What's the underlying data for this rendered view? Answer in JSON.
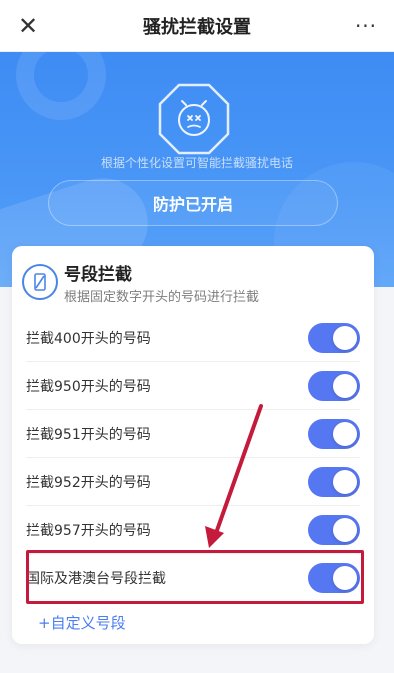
{
  "header": {
    "title": "骚扰拦截设置",
    "close_glyph": "✕",
    "more_glyph": "···"
  },
  "hero": {
    "subtitle": "根据个性化设置可智能拦截骚扰电话",
    "status": "防护已开启"
  },
  "card": {
    "title": "号段拦截",
    "description": "根据固定数字开头的号码进行拦截",
    "items": [
      {
        "label": "拦截400开头的号码",
        "enabled": true
      },
      {
        "label": "拦截950开头的号码",
        "enabled": true
      },
      {
        "label": "拦截951开头的号码",
        "enabled": true
      },
      {
        "label": "拦截952开头的号码",
        "enabled": true
      },
      {
        "label": "拦截957开头的号码",
        "enabled": true
      },
      {
        "label": "国际及港澳台号段拦截",
        "enabled": true
      }
    ],
    "add_label": "+自定义号段"
  },
  "colors": {
    "accent": "#5677f2",
    "hero_blue": "#3e8cf4",
    "annotation": "#c41a3b"
  }
}
